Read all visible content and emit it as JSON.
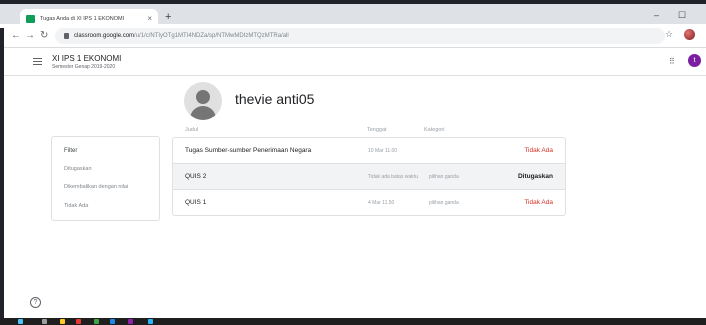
{
  "browser": {
    "tab_title": "Tugas Anda di XI IPS 1 EKONOMI",
    "tab_close": "×",
    "new_tab": "+",
    "url_host": "classroom.google.com",
    "url_path": "/u/1/c/NTIyOTg1MTI4NDZa/sp/NTMwMDIzMTQzMTRa/all",
    "minimize": "–",
    "maximize": "☐",
    "star": "☆"
  },
  "classroom": {
    "title": "XI IPS 1 EKONOMI",
    "subtitle": "Semester Genap 2019-2020",
    "avatar_letter": "t"
  },
  "student": {
    "name": "thevie anti05"
  },
  "filter": {
    "title": "Filter",
    "options": [
      "Ditugaskan",
      "Dikembalikan dengan nilai",
      "Tidak Ada"
    ]
  },
  "table": {
    "headers": {
      "title": "Judul",
      "due": "Tenggat",
      "category": "Kategori"
    },
    "rows": [
      {
        "title": "Tugas Sumber-sumber Penerimaan Negara",
        "due": "10 Mar 11.00",
        "category": "",
        "status": "Tidak Ada",
        "status_color": "#d93025"
      },
      {
        "title": "QUIS 2",
        "due": "Tidak ada batas waktu",
        "category": "pilihan ganda",
        "status": "Ditugaskan",
        "status_color": "#202124"
      },
      {
        "title": "QUIS 1",
        "due": "4 Mar 11.50",
        "category": "pilihan ganda",
        "status": "Tidak Ada",
        "status_color": "#d93025"
      }
    ]
  },
  "help_icon": "?",
  "colors": {
    "missing": "#d93025",
    "assigned": "#202124",
    "classroom_green": "#0f9d58",
    "avatar_purple": "#7b1fa2"
  }
}
